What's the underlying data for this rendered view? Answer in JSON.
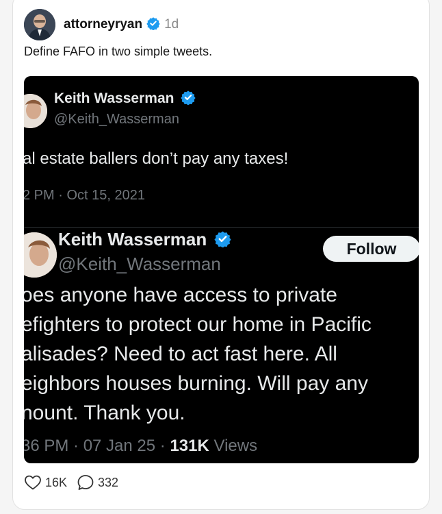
{
  "post": {
    "username": "attorneyryan",
    "age": "1d",
    "caption": "Define FAFO in two simple tweets.",
    "likes": "16K",
    "comments": "332"
  },
  "tweet_top": {
    "name": "Keith Wasserman",
    "handle": "@Keith_Wasserman",
    "text": "al estate ballers don’t pay any taxes!",
    "timestamp": "2 PM · Oct 15, 2021"
  },
  "tweet_bottom": {
    "name": "Keith Wasserman",
    "handle": "@Keith_Wasserman",
    "follow_label": "Follow",
    "lines": [
      "oes anyone have access to private",
      "efighters to protect our home in Pacific",
      "alisades? Need to act fast here. All",
      "eighbors houses burning. Will pay any",
      "nount. Thank you."
    ],
    "timestamp": "36 PM · 07 Jan 25 ·",
    "views_count": "131K",
    "views_label": "Views"
  },
  "colors": {
    "verified": "#1d9bf0",
    "background": "#000000"
  },
  "icons": {
    "verified": "verified-check-icon",
    "like": "heart-icon",
    "comment": "comment-bubble-icon"
  }
}
